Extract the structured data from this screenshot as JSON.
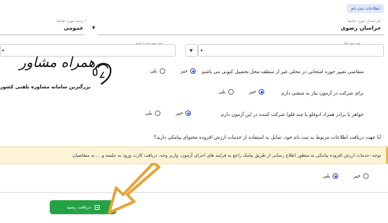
{
  "section_tag": "اطلاعات ثبت نام",
  "fields": {
    "province_label": "نام استان مورد تقاضا",
    "province_value": "خراسان رضوی",
    "quota_label": "* رشته مورد تقاضا",
    "quota_value": "عمومی",
    "exam_region_label": "مدرسه اول",
    "grade_label": "مدرسه دوره دوم"
  },
  "questions": {
    "q1": "متقاضی تغییر حوزه امتحانی در محلی غیر از منطقه محل تحصیل کنونی می باشم",
    "q2": "برای شرکت در آزمون نیاز به منشی دارم",
    "q3": "خواهر یا برادر همزاد ادوقلو یا چند قلو) شرکت کننده در این آزمون دارم",
    "q4": "آیا جهت دریافت اطلاعات مربوط به ثبت نام خود، تمایل به استفاده از خدمات ارزش افزوده محتوای پیامکی دارید؟"
  },
  "options": {
    "no": "خیر",
    "yes": "بلی"
  },
  "notice": "توجه: خدمات ارزش افزوده پیامکی به منظور اطلاع رسانی از طریق پیامک راجع به فرایند های اجرای آزمون، واریز وجه، دریافت کارت ورود به جلسه و ... به متقاضیان",
  "receipt_button": "دریافت رسید",
  "logo": {
    "title": "همراه مشاور",
    "subtitle": "بزرگترین سامانه مشاوره تلفنی کشور"
  },
  "colors": {
    "accent": "#1a3bd1",
    "button": "#25a244",
    "arrow": "#e8a23a",
    "notice_bg": "#fdf4d8"
  }
}
